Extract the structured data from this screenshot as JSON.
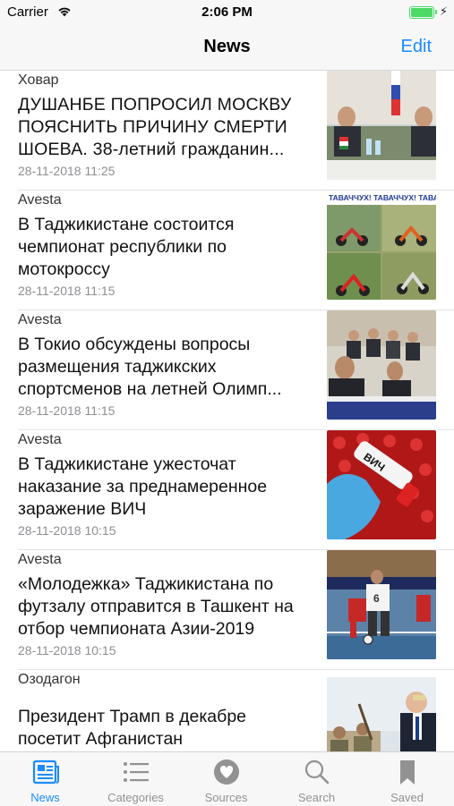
{
  "status_bar": {
    "carrier": "Carrier",
    "time": "2:06 PM"
  },
  "nav": {
    "title": "News",
    "edit_label": "Edit"
  },
  "articles": [
    {
      "source": "Ховар",
      "headline": "ДУШАНБЕ ПОПРОСИЛ МОСКВУ ПОЯСНИТЬ ПРИЧИНУ СМЕРТИ ШОЕВА. 38-летний гражданин...",
      "date": "28-11-2018 11:25",
      "thumb": "meeting-with-flags"
    },
    {
      "source": "Avesta",
      "headline": "В Таджикистане состоится чемпионат республики по мотокроссу",
      "date": "28-11-2018 11:15",
      "thumb": "motocross-collage",
      "thumb_caption": "ТАВАЧЧУХ! ТАВАЧЧУХ! ТАВАЧЧ"
    },
    {
      "source": "Avesta",
      "headline": "В Токио обсуждены вопросы размещения таджикских спортсменов на летней Олимп...",
      "date": "28-11-2018 11:15",
      "thumb": "conference-table"
    },
    {
      "source": "Avesta",
      "headline": "В Таджикистане ужесточат наказание за преднамеренное заражение ВИЧ",
      "date": "28-11-2018 10:15",
      "thumb": "hiv-test-tube",
      "thumb_caption": "ВИЧ"
    },
    {
      "source": "Avesta",
      "headline": "«Молодежка» Таджикистана по футзалу отправится в Ташкент на отбор чемпионата Азии-2019",
      "date": "28-11-2018 10:15",
      "thumb": "futsal-players"
    },
    {
      "source": "Озодагон",
      "headline": "Президент Трамп в декабре посетит Афганистан",
      "date": "",
      "thumb": "soldiers-and-president"
    }
  ],
  "tabs": [
    {
      "label": "News",
      "icon": "newspaper-icon",
      "active": true
    },
    {
      "label": "Categories",
      "icon": "list-icon",
      "active": false
    },
    {
      "label": "Sources",
      "icon": "heart-icon",
      "active": false
    },
    {
      "label": "Search",
      "icon": "search-icon",
      "active": false
    },
    {
      "label": "Saved",
      "icon": "bookmark-icon",
      "active": false
    }
  ],
  "colors": {
    "accent": "#1a8cff",
    "inactive": "#929292",
    "battery": "#4cd964"
  }
}
